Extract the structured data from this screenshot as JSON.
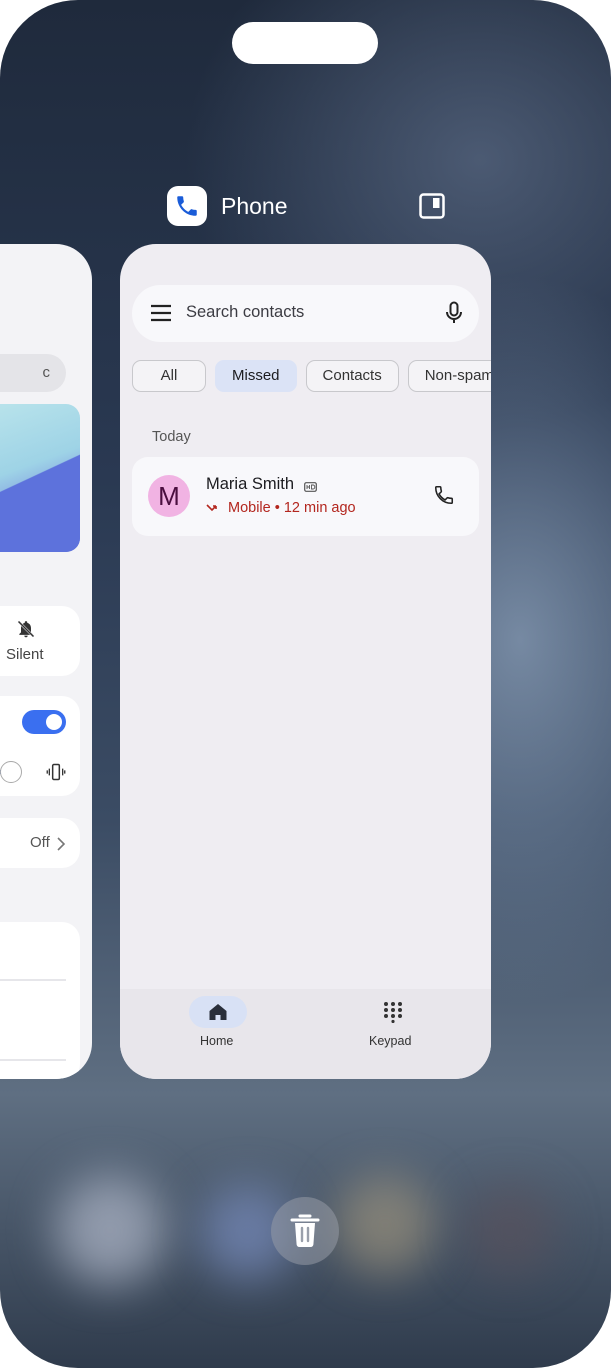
{
  "app_header": {
    "title": "Phone"
  },
  "left_card": {
    "search_fragment": "c",
    "silent_label": "Silent",
    "off_label": "Off"
  },
  "phone": {
    "search": {
      "placeholder": "Search contacts"
    },
    "filters": [
      "All",
      "Missed",
      "Contacts",
      "Non-spam"
    ],
    "selected_filter": "Missed",
    "section": "Today",
    "calls": [
      {
        "initial": "M",
        "name": "Maria Smith",
        "type": "Mobile",
        "time": "12 min ago",
        "status": "missed"
      }
    ],
    "nav": {
      "home": "Home",
      "keypad": "Keypad"
    }
  },
  "colors": {
    "accent": "#3a6ff0",
    "missed": "#b3261e",
    "avatar": "#f1b3e3"
  }
}
